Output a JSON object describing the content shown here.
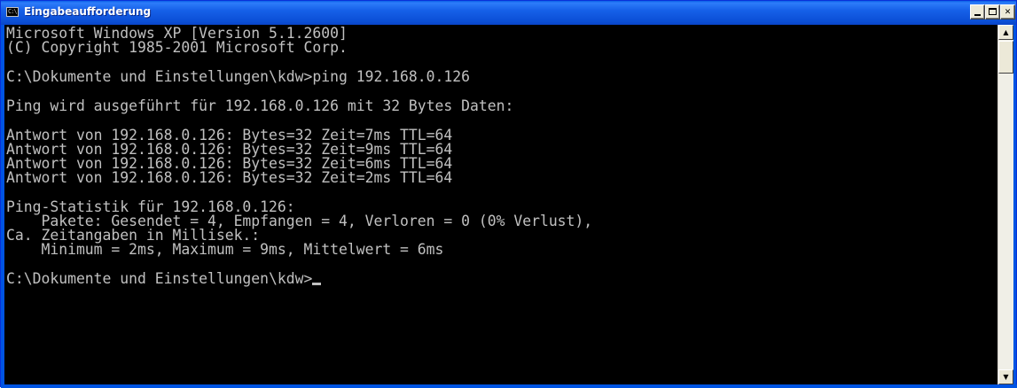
{
  "window": {
    "title": "Eingabeaufforderung",
    "icon": "console-icon",
    "icon_text": "C:\\",
    "buttons": [
      "minimize-icon",
      "maximize-icon",
      "close-icon"
    ],
    "close_glyph": "✕"
  },
  "console": {
    "lines": [
      "Microsoft Windows XP [Version 5.1.2600]",
      "(C) Copyright 1985-2001 Microsoft Corp.",
      "",
      "C:\\Dokumente und Einstellungen\\kdw>ping 192.168.0.126",
      "",
      "Ping wird ausgeführt für 192.168.0.126 mit 32 Bytes Daten:",
      "",
      "Antwort von 192.168.0.126: Bytes=32 Zeit=7ms TTL=64",
      "Antwort von 192.168.0.126: Bytes=32 Zeit=9ms TTL=64",
      "Antwort von 192.168.0.126: Bytes=32 Zeit=6ms TTL=64",
      "Antwort von 192.168.0.126: Bytes=32 Zeit=2ms TTL=64",
      "",
      "Ping-Statistik für 192.168.0.126:",
      "    Pakete: Gesendet = 4, Empfangen = 4, Verloren = 0 (0% Verlust),",
      "Ca. Zeitangaben in Millisek.:",
      "    Minimum = 2ms, Maximum = 9ms, Mittelwert = 6ms",
      "",
      "C:\\Dokumente und Einstellungen\\kdw>"
    ],
    "text_color": "#c0c0c0",
    "background_color": "#000000"
  },
  "scrollbar": {
    "up_glyph": "▲",
    "down_glyph": "▼"
  }
}
